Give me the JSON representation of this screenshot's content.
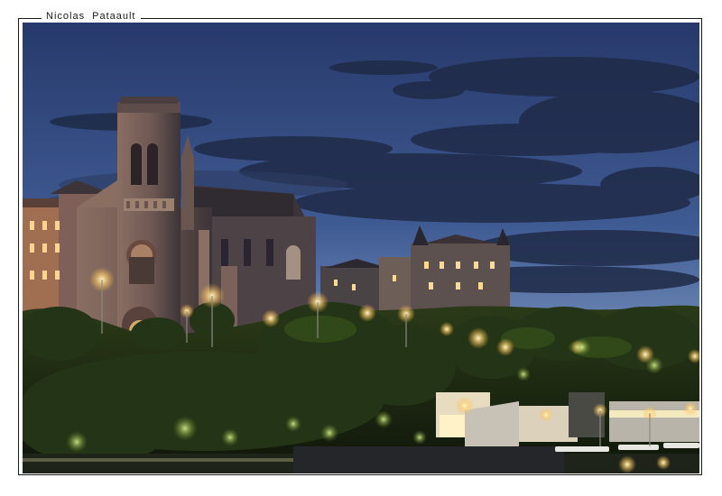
{
  "caption": {
    "text": "Nicolas   Pataault"
  },
  "photo": {
    "subject": "Église Sainte-Eugénie at dusk, illuminated town below, evening sky with clouds",
    "colors": {
      "sky_top": "#2c3f74",
      "sky_mid": "#4d6ba2",
      "sky_low": "#8ea9cb",
      "cloud": "#1c2640",
      "church": "#7a6058",
      "church_shadow": "#2e2a30",
      "foliage": "#1f2d12",
      "light": "#ffe9a8"
    }
  }
}
